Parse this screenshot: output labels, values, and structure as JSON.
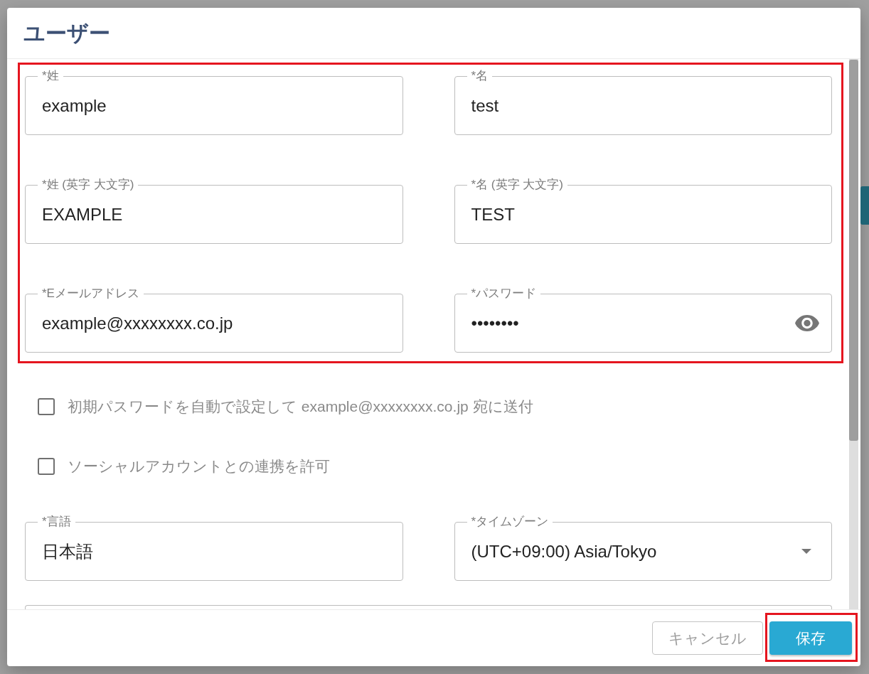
{
  "dialog": {
    "title": "ユーザー"
  },
  "sections": [
    {
      "kind": "fields",
      "highlighted": true,
      "fields": [
        {
          "kind": "text",
          "label": "*姓",
          "value": "example"
        },
        {
          "kind": "text",
          "label": "*名",
          "value": "test"
        },
        {
          "kind": "text",
          "label": "*姓 (英字 大文字)",
          "value": "EXAMPLE"
        },
        {
          "kind": "text",
          "label": "*名 (英字 大文字)",
          "value": "TEST"
        },
        {
          "kind": "text",
          "label": "*Eメールアドレス",
          "value": "example@xxxxxxxx.co.jp"
        },
        {
          "kind": "password",
          "label": "*パスワード",
          "value": "••••••••"
        }
      ]
    },
    {
      "kind": "checkboxes",
      "items": [
        {
          "label": "初期パスワードを自動で設定して example@xxxxxxxx.co.jp 宛に送付",
          "checked": false
        },
        {
          "label": "ソーシャルアカウントとの連携を許可",
          "checked": false
        }
      ]
    },
    {
      "kind": "fields",
      "highlighted": false,
      "fields": [
        {
          "kind": "text",
          "label": "*言語",
          "value": "日本語"
        },
        {
          "kind": "select",
          "label": "*タイムゾーン",
          "value": "(UTC+09:00) Asia/Tokyo"
        },
        {
          "kind": "partial"
        }
      ]
    }
  ],
  "footer": {
    "buttons": [
      {
        "label": "キャンセル",
        "kind": "outlined",
        "highlighted": false
      },
      {
        "label": "保存",
        "kind": "primary",
        "highlighted": true
      }
    ]
  }
}
